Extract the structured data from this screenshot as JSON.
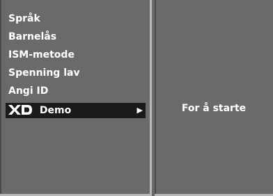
{
  "menu": {
    "items": [
      {
        "label": "Språk"
      },
      {
        "label": "Barnelås"
      },
      {
        "label": "ISM-metode"
      },
      {
        "label": "Spenning lav"
      },
      {
        "label": "Angi ID"
      }
    ],
    "selected": {
      "logo_text": "XD",
      "label": "Demo",
      "arrow_icon": "right-triangle-icon"
    }
  },
  "info": {
    "text": "For å starte"
  },
  "colors": {
    "background": "#6a6a6a",
    "selected_bg": "#1a1a1a",
    "divider": "#b9b9b9",
    "text": "#ffffff"
  }
}
